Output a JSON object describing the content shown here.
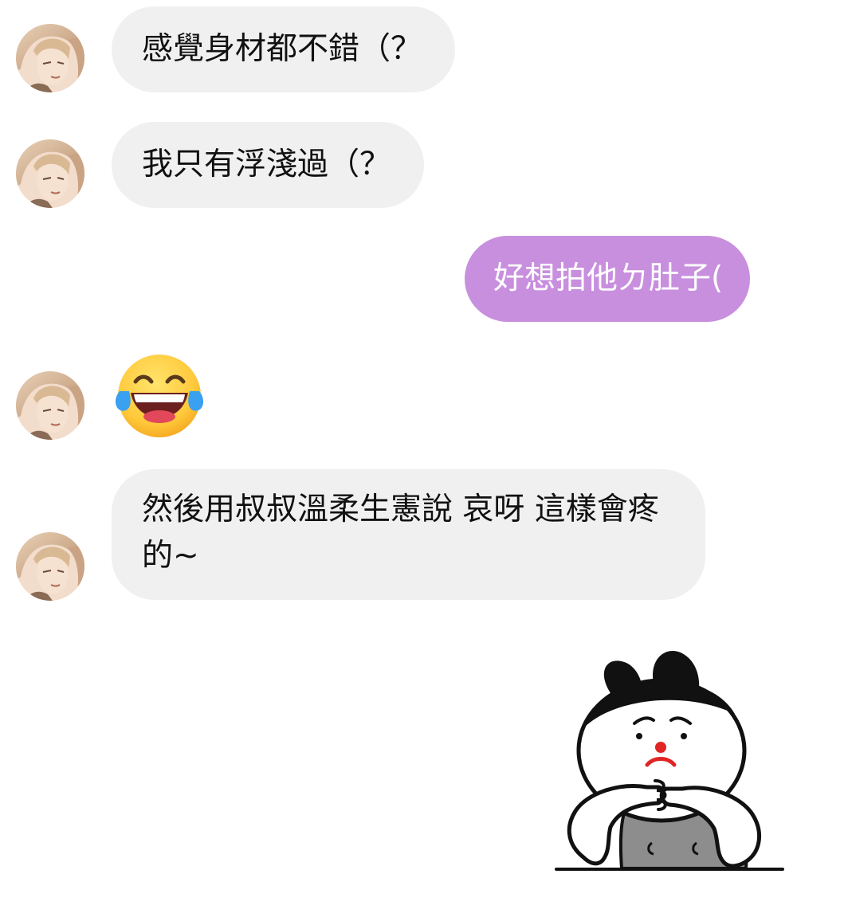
{
  "conversation": {
    "messages": [
      {
        "sender": "other",
        "text": "感覺身材都不錯（？"
      },
      {
        "sender": "other",
        "text": "我只有浮淺過（？"
      },
      {
        "sender": "me",
        "text": "好想拍他ㄉ肚子("
      },
      {
        "sender": "other",
        "emoji": "face-with-tears-of-joy"
      },
      {
        "sender": "other",
        "text": "然後用叔叔溫柔生憲說 哀呀 這樣會疼的~"
      },
      {
        "sender": "me",
        "sticker": "worried-bunny-sticker"
      }
    ]
  },
  "colors": {
    "incoming_bubble": "#f0f0f0",
    "outgoing_bubble": "#c88fde"
  }
}
